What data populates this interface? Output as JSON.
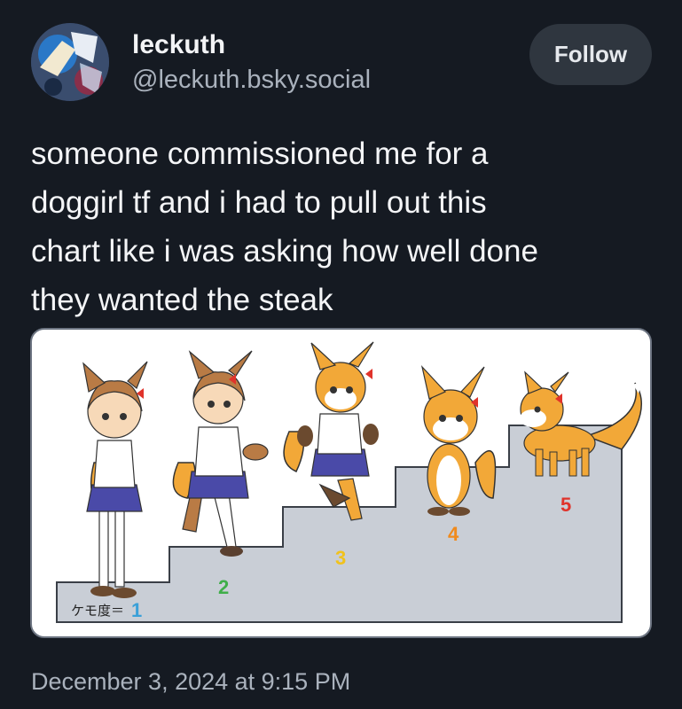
{
  "author": {
    "display_name": "leckuth",
    "handle": "@leckuth.bsky.social",
    "avatar_icon": "avatar-icon"
  },
  "follow_label": "Follow",
  "post": {
    "lines": [
      "someone commissioned me for a",
      "doggirl tf and i had to pull out this",
      "chart like i was asking how well done",
      "they wanted the steak"
    ],
    "timestamp": "December 3, 2024 at 9:15 PM"
  },
  "image": {
    "scale_label": "ケモ度＝",
    "steps": [
      "1",
      "2",
      "3",
      "4",
      "5"
    ],
    "colors": {
      "stairs": "#c9ced6",
      "fox_orange": "#f2a838",
      "fox_white": "#ffffff",
      "hair_brown": "#b97b45",
      "skirt_blue": "#4a4aa8",
      "step_number_red": "#e0332b",
      "step_number_green": "#3fae49",
      "step_number_yellow": "#f1c21b",
      "step_number_orange": "#f08a1c"
    }
  },
  "theme": {
    "background": "#151a22",
    "muted_text": "#aab2bd",
    "button_bg": "#2f363f"
  }
}
